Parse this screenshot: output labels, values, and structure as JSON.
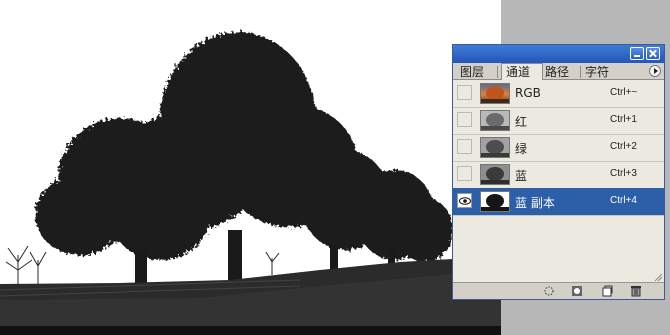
{
  "panel": {
    "tabs": [
      {
        "label": "图层"
      },
      {
        "label": "通道"
      },
      {
        "label": "路径"
      },
      {
        "label": "字符"
      }
    ],
    "active_tab": "通道",
    "channels": [
      {
        "name": "RGB",
        "shortcut": "Ctrl+~",
        "visible": false,
        "selected": false,
        "thumb_color": "#c0672a"
      },
      {
        "name": "红",
        "shortcut": "Ctrl+1",
        "visible": false,
        "selected": false,
        "thumb_color": "#8a8a8a"
      },
      {
        "name": "绿",
        "shortcut": "Ctrl+2",
        "visible": false,
        "selected": false,
        "thumb_color": "#6e6e6e"
      },
      {
        "name": "蓝",
        "shortcut": "Ctrl+3",
        "visible": false,
        "selected": false,
        "thumb_color": "#555555"
      },
      {
        "name": "蓝 副本",
        "shortcut": "Ctrl+4",
        "visible": true,
        "selected": true,
        "thumb_color": "#222222"
      }
    ],
    "bottom_icons": [
      "load-selection-icon",
      "save-selection-icon",
      "new-channel-icon",
      "delete-channel-icon"
    ]
  },
  "colors": {
    "selection": "#2c5fa8",
    "titlebar": "#2356b8",
    "panel_bg": "#ece9e1"
  }
}
